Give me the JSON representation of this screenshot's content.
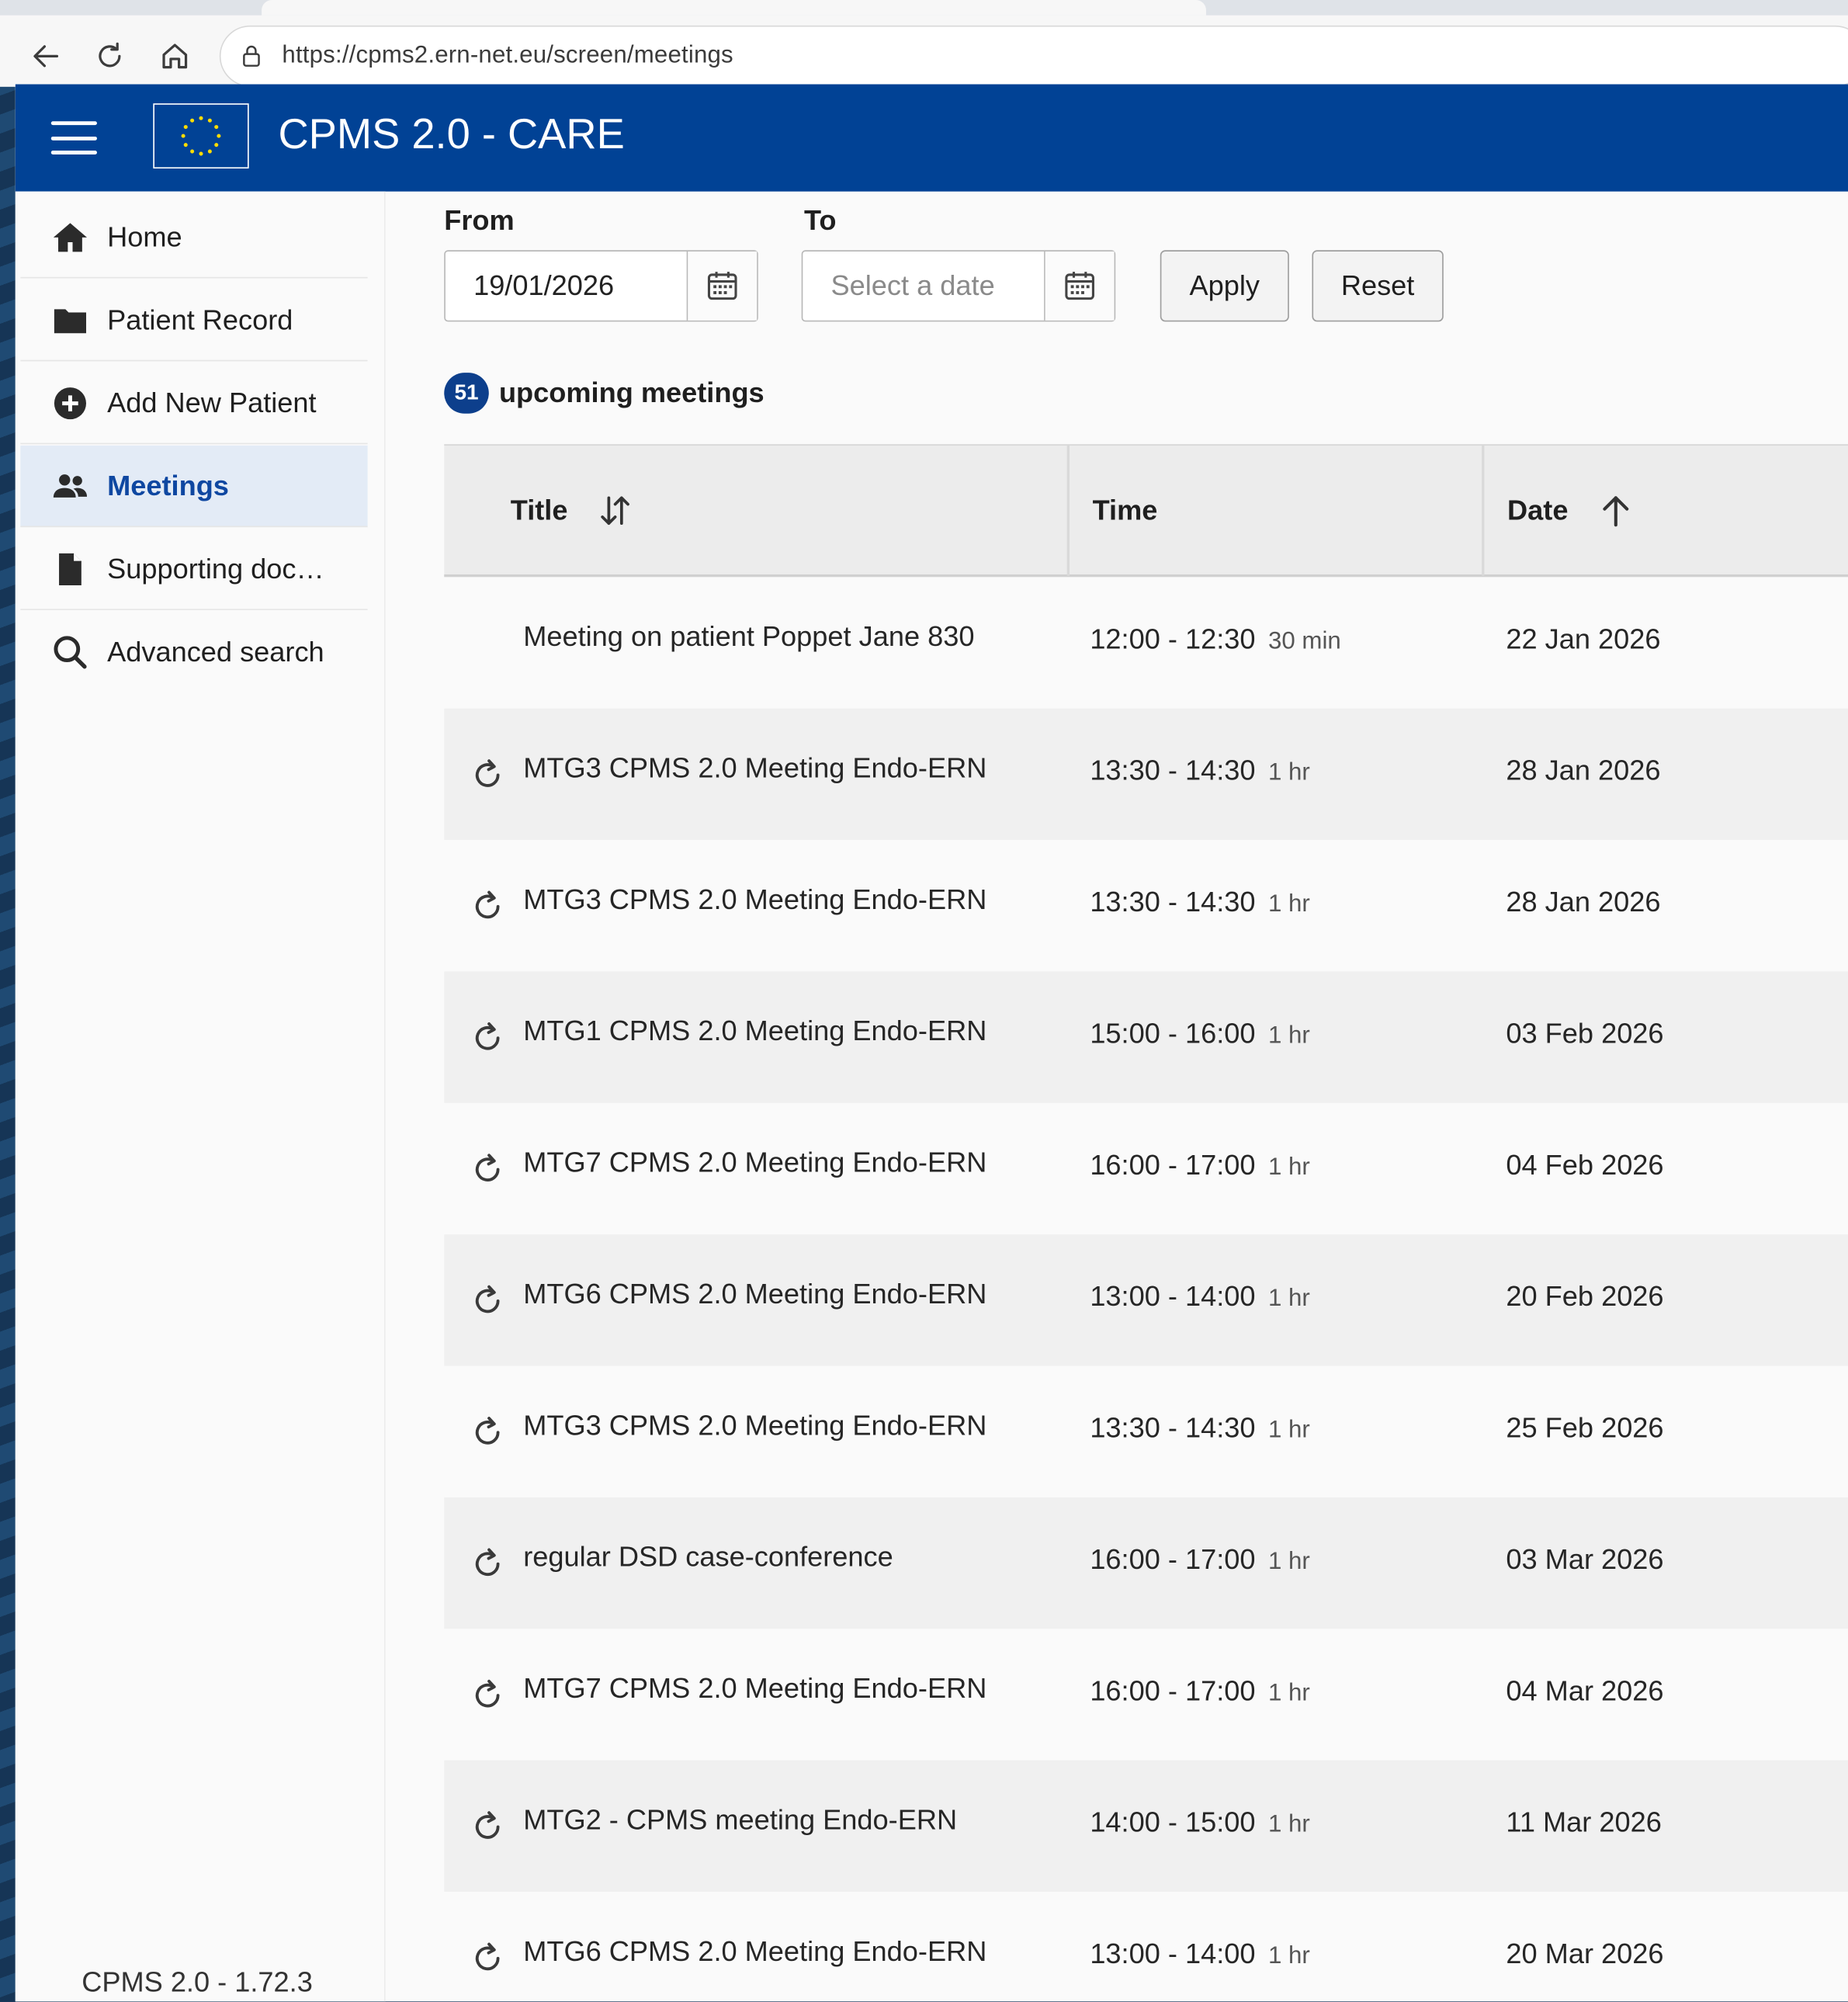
{
  "browser": {
    "url": "https://cpms2.ern-net.eu/screen/meetings"
  },
  "header": {
    "title": "CPMS 2.0 - CARE"
  },
  "sidebar": {
    "items": [
      {
        "label": "Home",
        "icon": "home-icon"
      },
      {
        "label": "Patient Record",
        "icon": "folder-icon"
      },
      {
        "label": "Add New Patient",
        "icon": "plus-circle-icon"
      },
      {
        "label": "Meetings",
        "icon": "users-icon",
        "active": true
      },
      {
        "label": "Supporting doc…",
        "icon": "document-icon"
      },
      {
        "label": "Advanced search",
        "icon": "search-icon"
      }
    ],
    "version": "CPMS 2.0 - 1.72.3"
  },
  "filters": {
    "from_label": "From",
    "from_value": "19/01/2026",
    "to_label": "To",
    "to_placeholder": "Select a date",
    "apply_label": "Apply",
    "reset_label": "Reset"
  },
  "summary": {
    "count": "51",
    "text": "upcoming meetings"
  },
  "table": {
    "columns": {
      "title": "Title",
      "time": "Time",
      "date": "Date"
    },
    "rows": [
      {
        "title": "Meeting on patient Poppet Jane 830",
        "time": "12:00 - 12:30",
        "duration": "30 min",
        "date": "22 Jan 2026",
        "recurring": false
      },
      {
        "title": "MTG3 CPMS 2.0 Meeting Endo-ERN",
        "time": "13:30 - 14:30",
        "duration": "1 hr",
        "date": "28 Jan 2026",
        "recurring": true
      },
      {
        "title": "MTG3 CPMS 2.0 Meeting Endo-ERN",
        "time": "13:30 - 14:30",
        "duration": "1 hr",
        "date": "28 Jan 2026",
        "recurring": true
      },
      {
        "title": "MTG1 CPMS 2.0 Meeting Endo-ERN",
        "time": "15:00 - 16:00",
        "duration": "1 hr",
        "date": "03 Feb 2026",
        "recurring": true
      },
      {
        "title": "MTG7 CPMS 2.0 Meeting Endo-ERN",
        "time": "16:00 - 17:00",
        "duration": "1 hr",
        "date": "04 Feb 2026",
        "recurring": true
      },
      {
        "title": "MTG6 CPMS 2.0 Meeting Endo-ERN",
        "time": "13:00 - 14:00",
        "duration": "1 hr",
        "date": "20 Feb 2026",
        "recurring": true
      },
      {
        "title": "MTG3 CPMS 2.0 Meeting Endo-ERN",
        "time": "13:30 - 14:30",
        "duration": "1 hr",
        "date": "25 Feb 2026",
        "recurring": true
      },
      {
        "title": "regular DSD case-conference",
        "time": "16:00 - 17:00",
        "duration": "1 hr",
        "date": "03 Mar 2026",
        "recurring": true
      },
      {
        "title": "MTG7 CPMS 2.0 Meeting Endo-ERN",
        "time": "16:00 - 17:00",
        "duration": "1 hr",
        "date": "04 Mar 2026",
        "recurring": true
      },
      {
        "title": "MTG2 - CPMS meeting Endo-ERN",
        "time": "14:00 - 15:00",
        "duration": "1 hr",
        "date": "11 Mar 2026",
        "recurring": true
      },
      {
        "title": "MTG6 CPMS 2.0 Meeting Endo-ERN",
        "time": "13:00 - 14:00",
        "duration": "1 hr",
        "date": "20 Mar 2026",
        "recurring": true
      }
    ]
  },
  "colors": {
    "brand": "#014295",
    "active_bg": "#e3ebf6",
    "badge": "#0d3f8c"
  }
}
